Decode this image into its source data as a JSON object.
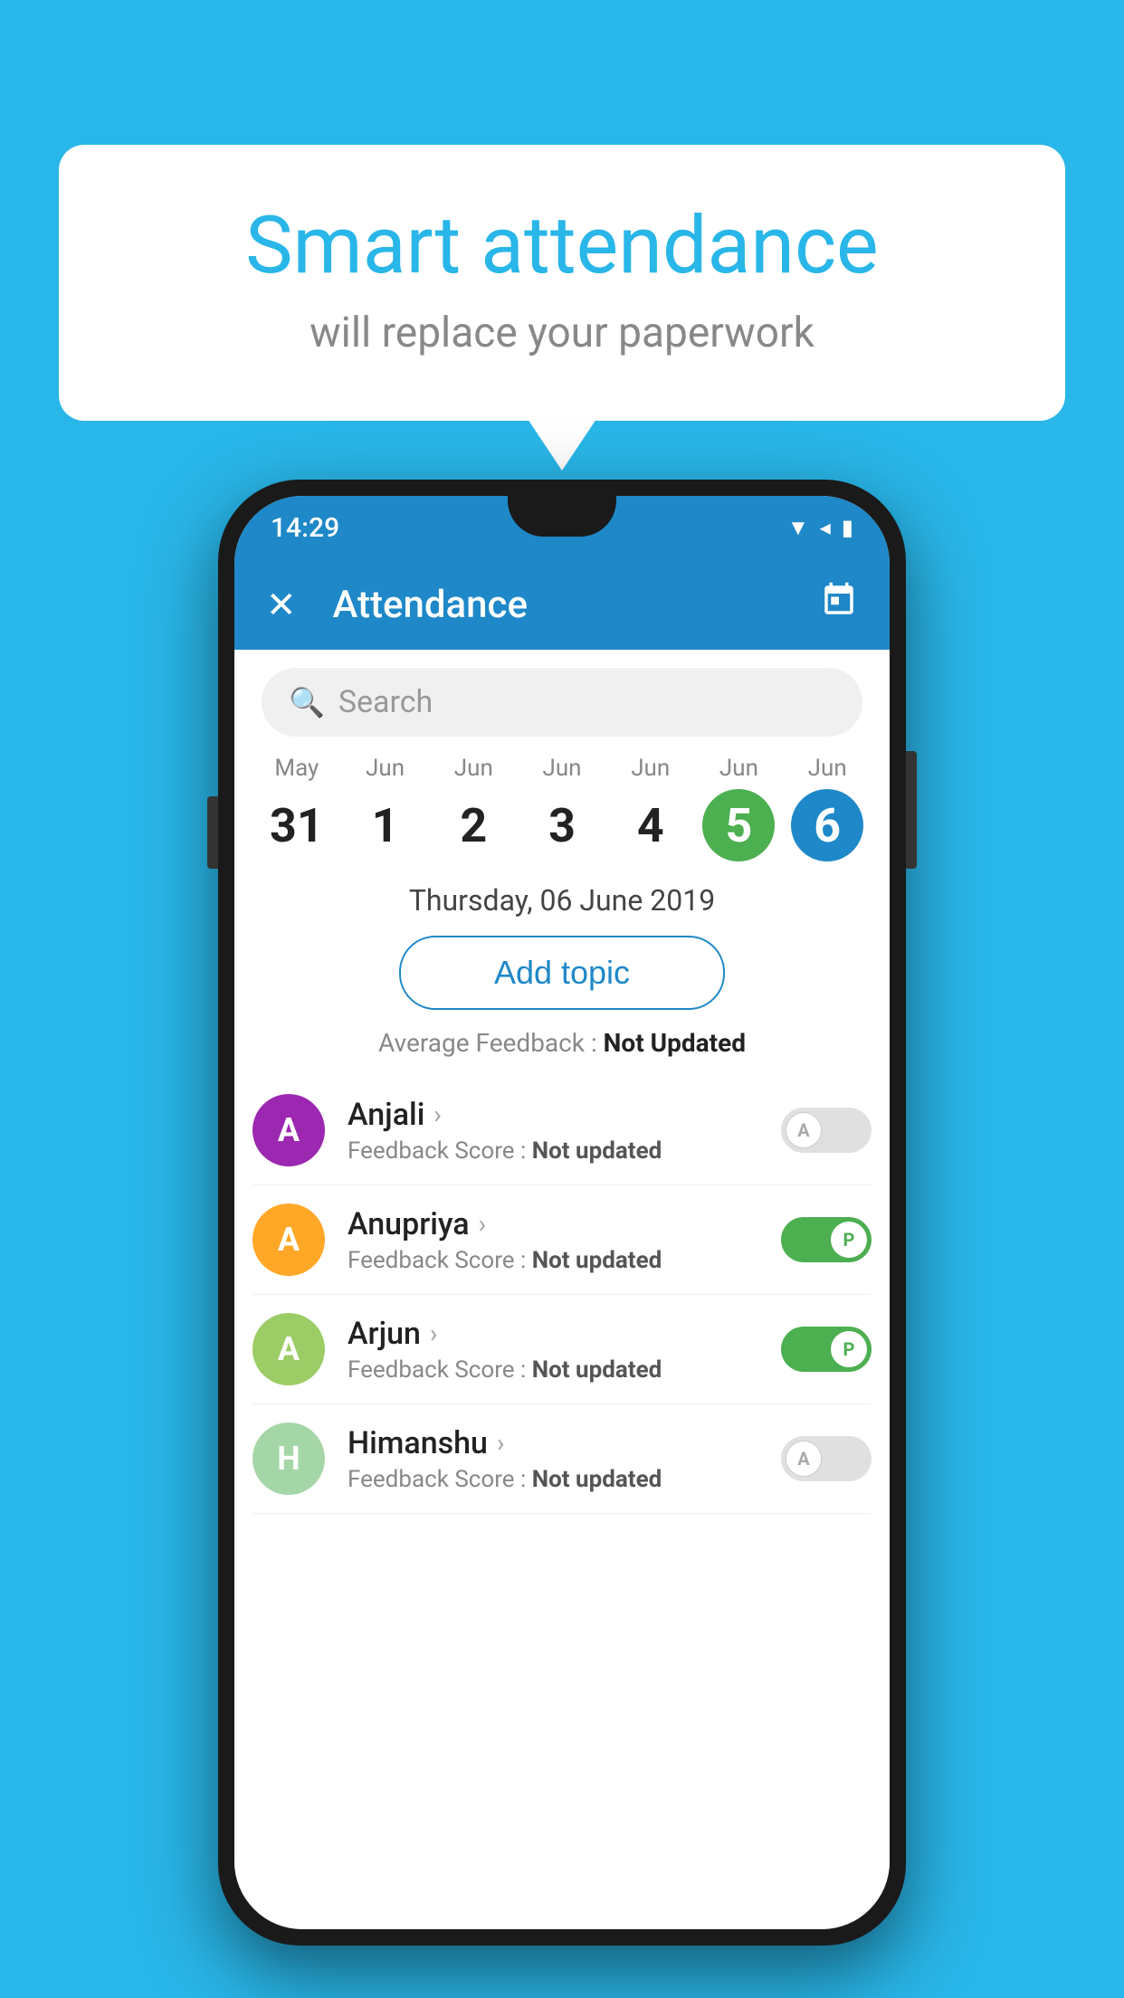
{
  "page": {
    "background_color": "#29b6e8"
  },
  "speech_bubble": {
    "title": "Smart attendance",
    "subtitle": "will replace your paperwork"
  },
  "status_bar": {
    "time": "14:29",
    "wifi_icon": "▲",
    "signal_icon": "◀",
    "battery_icon": "▮"
  },
  "app_bar": {
    "title": "Attendance",
    "close_icon": "✕",
    "calendar_icon": "📅"
  },
  "search": {
    "placeholder": "Search"
  },
  "calendar": {
    "days": [
      {
        "month": "May",
        "date": "31",
        "style": "normal"
      },
      {
        "month": "Jun",
        "date": "1",
        "style": "normal"
      },
      {
        "month": "Jun",
        "date": "2",
        "style": "normal"
      },
      {
        "month": "Jun",
        "date": "3",
        "style": "normal"
      },
      {
        "month": "Jun",
        "date": "4",
        "style": "normal"
      },
      {
        "month": "Jun",
        "date": "5",
        "style": "green"
      },
      {
        "month": "Jun",
        "date": "6",
        "style": "blue"
      }
    ]
  },
  "selected_date": "Thursday, 06 June 2019",
  "add_topic_label": "Add topic",
  "average_feedback": {
    "label": "Average Feedback : ",
    "value": "Not Updated"
  },
  "students": [
    {
      "name": "Anjali",
      "avatar_letter": "A",
      "avatar_color": "#9c27b0",
      "feedback_label": "Feedback Score : ",
      "feedback_value": "Not updated",
      "attendance": "absent"
    },
    {
      "name": "Anupriya",
      "avatar_letter": "A",
      "avatar_color": "#ffa726",
      "feedback_label": "Feedback Score : ",
      "feedback_value": "Not updated",
      "attendance": "present"
    },
    {
      "name": "Arjun",
      "avatar_letter": "A",
      "avatar_color": "#9ccc65",
      "feedback_label": "Feedback Score : ",
      "feedback_value": "Not updated",
      "attendance": "present"
    },
    {
      "name": "Himanshu",
      "avatar_letter": "H",
      "avatar_color": "#a5d6a7",
      "feedback_label": "Feedback Score : ",
      "feedback_value": "Not updated",
      "attendance": "absent"
    }
  ],
  "icons": {
    "search": "🔍",
    "close": "✕",
    "chevron": "›",
    "calendar": "▦"
  }
}
